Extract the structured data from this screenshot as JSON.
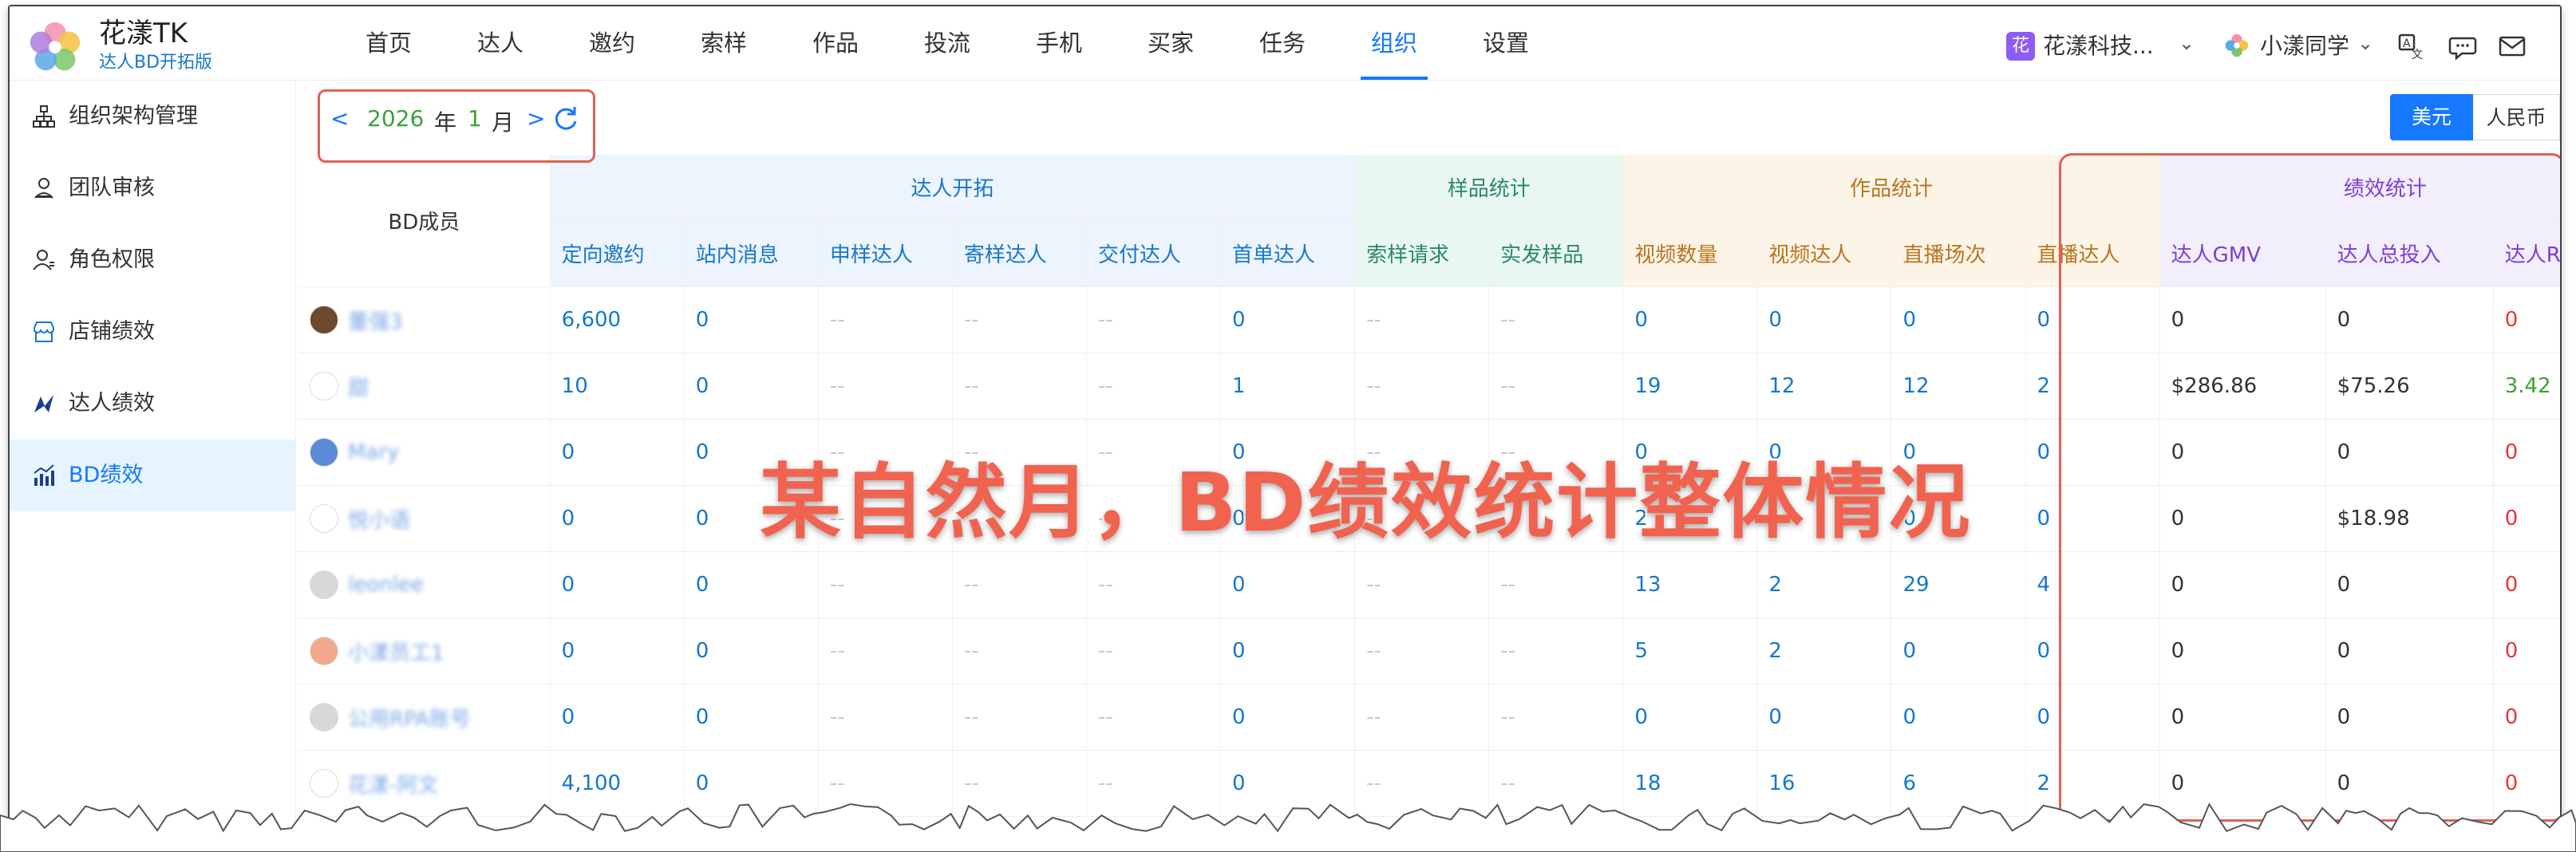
{
  "app": {
    "brand": "花漾TK",
    "subtitle": "达人BD开拓版"
  },
  "nav": {
    "items": [
      "首页",
      "达人",
      "邀约",
      "索样",
      "作品",
      "投流",
      "手机",
      "买家",
      "任务",
      "组织",
      "设置"
    ],
    "active": "组织"
  },
  "header": {
    "org_badge": "花",
    "org_name": "花漾科技...",
    "user_name": "小漾同学"
  },
  "sidebar": {
    "items": [
      {
        "label": "组织架构管理",
        "icon": "org-tree-icon"
      },
      {
        "label": "团队审核",
        "icon": "user-review-icon"
      },
      {
        "label": "角色权限",
        "icon": "role-icon"
      },
      {
        "label": "店铺绩效",
        "icon": "shop-icon"
      },
      {
        "label": "达人绩效",
        "icon": "creator-icon"
      },
      {
        "label": "BD绩效",
        "icon": "chart-icon",
        "active": true
      }
    ]
  },
  "date": {
    "year": "2026",
    "year_unit": "年",
    "month": "1",
    "month_unit": "月"
  },
  "currency": {
    "usd": "美元",
    "rmb": "人民币",
    "selected": "美元"
  },
  "table": {
    "member_header": "BD成员",
    "groups": [
      {
        "label": "达人开拓"
      },
      {
        "label": "样品统计"
      },
      {
        "label": "作品统计"
      },
      {
        "label": "绩效统计"
      }
    ],
    "columns": [
      "定向邀约",
      "站内消息",
      "申样达人",
      "寄样达人",
      "交付达人",
      "首单达人",
      "索样请求",
      "实发样品",
      "视频数量",
      "视频达人",
      "直播场次",
      "直播达人",
      "达人GMV",
      "达人总投入",
      "达人ROI"
    ],
    "rows": [
      {
        "name": "董强3",
        "cells": [
          "6,600",
          "0",
          "--",
          "--",
          "--",
          "0",
          "--",
          "--",
          "0",
          "0",
          "0",
          "0",
          "0",
          "0",
          "0"
        ]
      },
      {
        "name": "甜",
        "cells": [
          "10",
          "0",
          "--",
          "--",
          "--",
          "1",
          "--",
          "--",
          "19",
          "12",
          "12",
          "2",
          "$286.86",
          "$75.26",
          "3.42"
        ]
      },
      {
        "name": "Mary",
        "cells": [
          "0",
          "0",
          "--",
          "--",
          "--",
          "0",
          "--",
          "--",
          "0",
          "0",
          "0",
          "0",
          "0",
          "0",
          "0"
        ]
      },
      {
        "name": "悦小语",
        "cells": [
          "0",
          "0",
          "--",
          "--",
          "--",
          "0",
          "--",
          "--",
          "2",
          "1",
          "0",
          "0",
          "0",
          "$18.98",
          "0"
        ]
      },
      {
        "name": "leonlee",
        "cells": [
          "0",
          "0",
          "--",
          "--",
          "--",
          "0",
          "--",
          "--",
          "13",
          "2",
          "29",
          "4",
          "0",
          "0",
          "0"
        ]
      },
      {
        "name": "小漾员工1",
        "cells": [
          "0",
          "0",
          "--",
          "--",
          "--",
          "0",
          "--",
          "--",
          "5",
          "2",
          "0",
          "0",
          "0",
          "0",
          "0"
        ]
      },
      {
        "name": "公用RPA账号",
        "cells": [
          "0",
          "0",
          "--",
          "--",
          "--",
          "0",
          "--",
          "--",
          "0",
          "0",
          "0",
          "0",
          "0",
          "0",
          "0"
        ]
      },
      {
        "name": "花漾-阿文",
        "cells": [
          "4,100",
          "0",
          "--",
          "--",
          "--",
          "0",
          "--",
          "--",
          "18",
          "16",
          "6",
          "2",
          "0",
          "0",
          "0"
        ]
      }
    ]
  },
  "annotation": {
    "text": "某自然月，BD绩效统计整体情况"
  },
  "colors": {
    "accent": "#1677ff",
    "annotation": "#f1624f",
    "group_recruit": "#eef4fd",
    "group_sample": "#e9f7f2",
    "group_works": "#fdf4e8",
    "group_perf": "#f3eefc"
  }
}
